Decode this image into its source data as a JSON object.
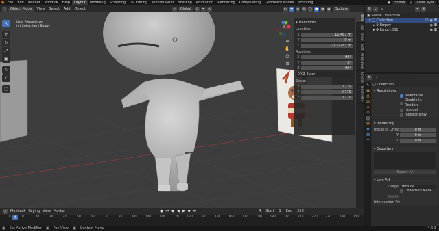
{
  "topbar": {
    "logo": "◉",
    "menus": [
      "File",
      "Edit",
      "Render",
      "Window",
      "Help"
    ],
    "workspaces": [
      "Layout",
      "Modeling",
      "Sculpting",
      "UV Editing",
      "Texture Paint",
      "Shading",
      "Animation",
      "Rendering",
      "Compositing",
      "Geometry Nodes",
      "Scripting"
    ],
    "active_workspace": "Layout",
    "scene": "Scene",
    "view_layer": "ViewLayer"
  },
  "viewport_header": {
    "mode": "Object Mode",
    "menus": [
      "View",
      "Select",
      "Add",
      "Object"
    ],
    "orientation": "Global",
    "options": "Options"
  },
  "viewport": {
    "perspective": "User Perspective",
    "collection_path": "(4) Collection | Empty"
  },
  "toolbar_tools": [
    "↖",
    "✛",
    "↻",
    "⤢",
    "▣",
    "✎",
    "∠",
    "⬚"
  ],
  "npanel": {
    "header": "Transform",
    "location": {
      "label": "Location:",
      "x": "11.467 m",
      "y": "0 m",
      "z": "-0.32283 m"
    },
    "rotation": {
      "label": "Rotation:",
      "x": "90°",
      "y": "0°",
      "z": "90°",
      "mode": "XYZ Euler"
    },
    "scale": {
      "label": "Scale:",
      "x": "0.779",
      "y": "0.779",
      "z": "0.779"
    },
    "tabs": [
      "Item",
      "Tool",
      "View",
      "Edit",
      "Animation",
      "Create",
      "Geometry"
    ]
  },
  "timeline": {
    "menus": [
      "Playback",
      "Keying",
      "View",
      "Marker"
    ],
    "current_frame": "4",
    "start_label": "Start",
    "start": "1",
    "end_label": "End",
    "end": "250",
    "ticks": [
      "0",
      "10",
      "20",
      "30",
      "40",
      "50",
      "60",
      "70",
      "80",
      "90",
      "100",
      "110",
      "120",
      "130",
      "140",
      "150",
      "160",
      "170",
      "180",
      "190",
      "200",
      "210",
      "220",
      "230",
      "240",
      "250"
    ],
    "playhead": "4"
  },
  "statusbar": {
    "items": [
      "Set Active Modifier",
      "Pan View",
      "Context Menu"
    ],
    "version": "4.4.3"
  },
  "outliner": {
    "title": "Scene Collection",
    "rows": [
      {
        "label": "Collection",
        "selected": true
      },
      {
        "label": "Empty",
        "selected": false
      },
      {
        "label": "Empty.001",
        "selected": false
      }
    ]
  },
  "properties": {
    "title": "Collection",
    "restrictions": {
      "title": "Restrictions",
      "selectable": "Selectable",
      "disable_renders": "Disable in Renders",
      "holdout": "Holdout",
      "indirect_only": "Indirect Only"
    },
    "instancing": {
      "title": "Instancing",
      "offset_label": "Instance Offset X",
      "y_label": "Y",
      "z_label": "Z",
      "x": "0 m",
      "y": "0 m",
      "z": "0 m"
    },
    "exporters": {
      "title": "Exporters",
      "button": "Export All"
    },
    "lineart": {
      "title": "Line Art",
      "usage_label": "Usage",
      "usage": "Include",
      "collection_mask": "Collection Mask",
      "masks_label": "Masks",
      "intersection_label": "Intersection Pri..."
    }
  },
  "colors": {
    "accent": "#4772b3",
    "logo": "#e87d0d",
    "viewport_bg": "#3d3d3d",
    "axis_x": "#e5414f",
    "axis_y": "#89b63d",
    "axis_z": "#3c82d4"
  }
}
